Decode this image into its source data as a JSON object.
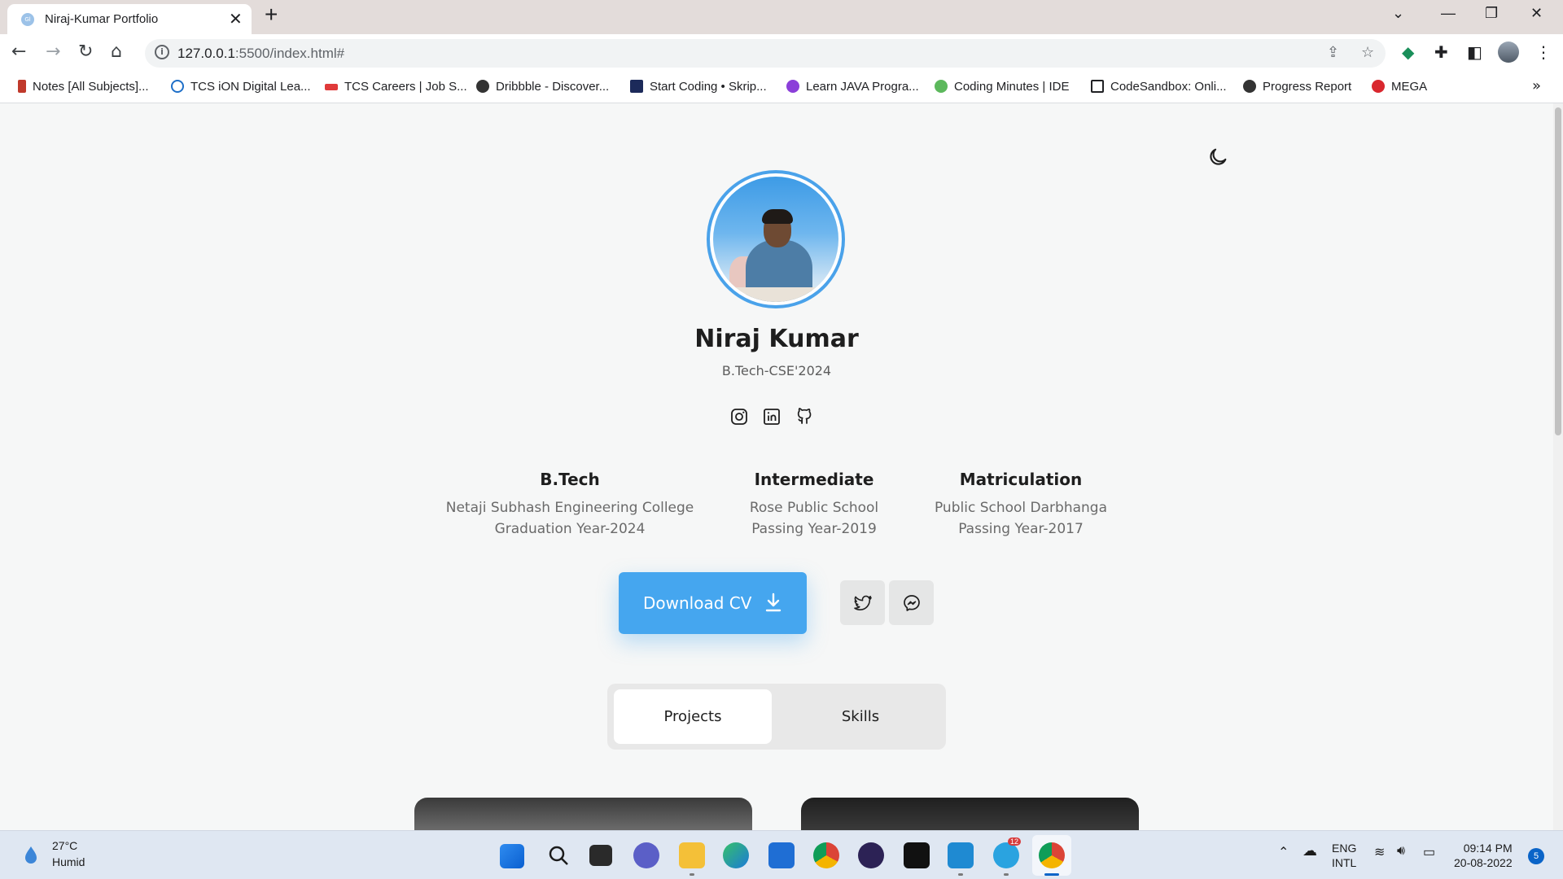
{
  "browser": {
    "tab_title": "Niraj-Kumar Portfolio",
    "tab_favicon": "Gl",
    "url_host": "127.0.0.1",
    "url_rest": ":5500/index.html#",
    "bookmarks": [
      "Notes [All Subjects]...",
      "TCS iON Digital Lea...",
      "TCS Careers | Job S...",
      "Dribbble - Discover...",
      "Start Coding • Skrip...",
      "Learn JAVA Progra...",
      "Coding Minutes | IDE",
      "CodeSandbox: Onli...",
      "Progress Report",
      "MEGA"
    ]
  },
  "profile": {
    "name": "Niraj Kumar",
    "degree": "B.Tech-CSE'2024"
  },
  "education": [
    {
      "title": "B.Tech",
      "line1": "Netaji Subhash Engineering College",
      "line2": "Graduation Year-2024"
    },
    {
      "title": "Intermediate",
      "line1": "Rose Public School",
      "line2": "Passing Year-2019"
    },
    {
      "title": "Matriculation",
      "line1": "Public School Darbhanga",
      "line2": "Passing Year-2017"
    }
  ],
  "actions": {
    "download_label": "Download CV"
  },
  "tabs": {
    "projects": "Projects",
    "skills": "Skills"
  },
  "colors": {
    "accent": "#45a6ef",
    "ring": "#4aa2ea"
  },
  "taskbar": {
    "temperature": "27°C",
    "weather": "Humid",
    "lang1": "ENG",
    "lang2": "INTL",
    "time": "09:14 PM",
    "date": "20-08-2022",
    "notifications": "5",
    "telegram_badge": "12"
  }
}
